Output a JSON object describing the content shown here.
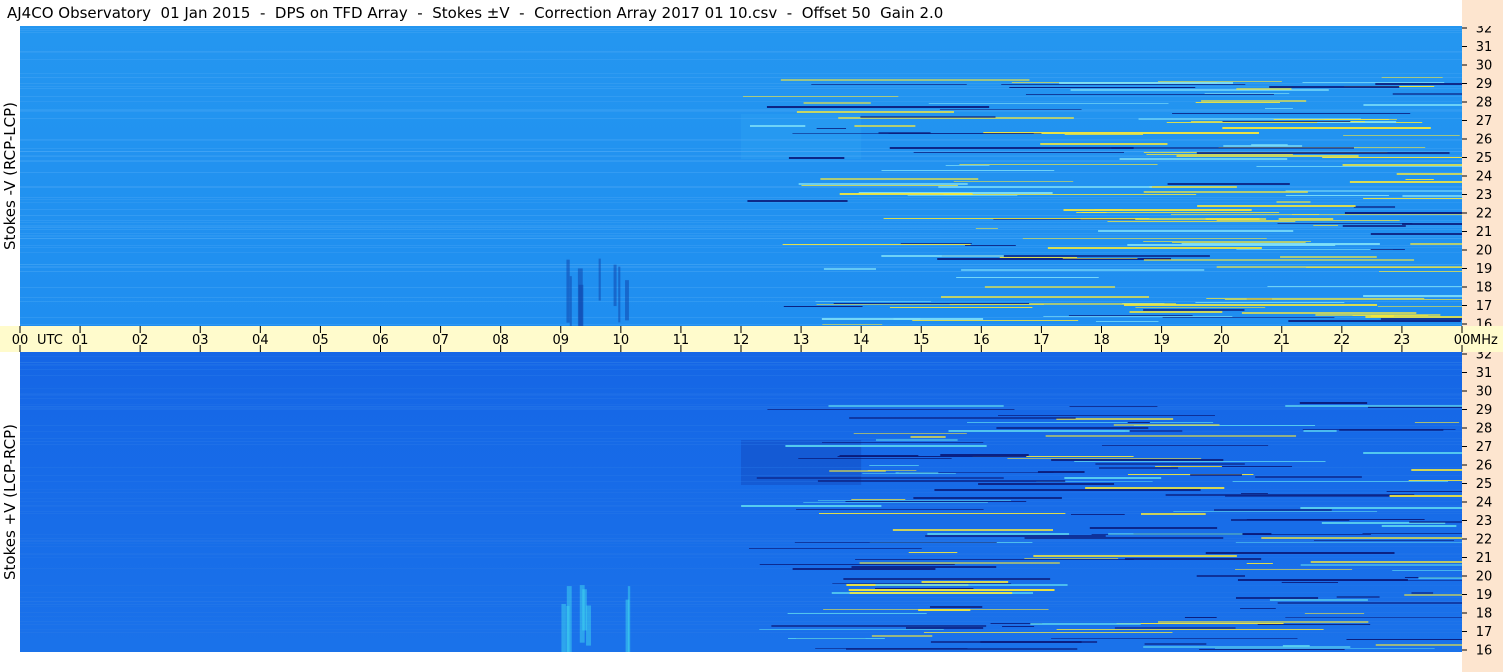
{
  "header": {
    "title": "AJ4CO Observatory  01 Jan 2015  -  DPS on TFD Array  -  Stokes ±V  -  Correction Array 2017 01 10.csv  -  Offset 50  Gain 2.0"
  },
  "chart_data": {
    "type": "heatmap",
    "title": "AJ4CO Observatory  01 Jan 2015  -  DPS on TFD Array  -  Stokes ±V  -  Correction Array 2017 01 10.csv  -  Offset 50  Gain 2.0",
    "x_axis": {
      "label": "UTC",
      "ticks": [
        "00",
        "01",
        "02",
        "03",
        "04",
        "05",
        "06",
        "07",
        "08",
        "09",
        "10",
        "11",
        "12",
        "13",
        "14",
        "15",
        "16",
        "17",
        "18",
        "19",
        "20",
        "21",
        "22",
        "23",
        "00"
      ],
      "range": [
        0,
        24
      ]
    },
    "y_axis": {
      "unit": "MHz",
      "ticks": [
        "32",
        "31",
        "30",
        "29",
        "28",
        "27",
        "26",
        "25",
        "24",
        "23",
        "22",
        "21",
        "20",
        "19",
        "18",
        "17",
        "16"
      ],
      "range": [
        16,
        32
      ]
    },
    "panels": [
      {
        "label": "Stokes -V (RCP-LCP)",
        "base_color": "#1c8fec"
      },
      {
        "label": "Stokes +V (LCP-RCP)",
        "base_color": "#1566e0"
      }
    ],
    "colors": {
      "left_panel_top": "#2496f0",
      "left_panel_bottom": "#1f8ef0",
      "right_panel_top": "#1566e6",
      "right_panel_bottom": "#1a72ea",
      "time_axis_bg": "#fffbcc",
      "freq_axis_bg": "#fde5cf",
      "hot_line": "#f5e83a",
      "cold_line": "#0a1a7a"
    }
  }
}
